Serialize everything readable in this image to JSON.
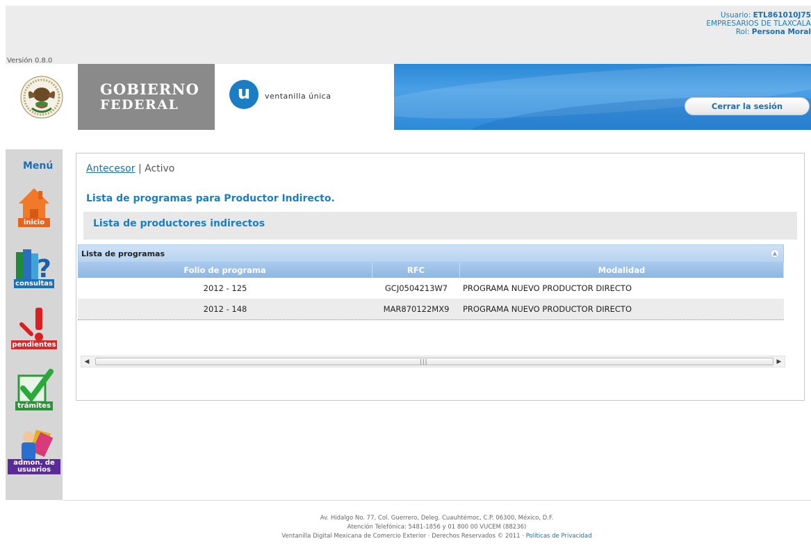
{
  "header": {
    "version": "Versión 0.8.0",
    "user_label": "Usuario:",
    "user_id": "ETL861010J75",
    "company": "EMPRESARIOS DE TLAXCALA",
    "role_label": "Rol:",
    "role": "Persona Moral"
  },
  "banner": {
    "gobierno_line1": "Gobierno",
    "gobierno_line2": "FEDERAL",
    "vu_letter": "u",
    "vu_text": "ventanilla única",
    "logout_label": "Cerrar la sesión"
  },
  "sidebar": {
    "title": "Menú",
    "items": [
      {
        "label": "inicio",
        "icon": "house-icon"
      },
      {
        "label": "consultas",
        "icon": "question-icon"
      },
      {
        "label": "pendientes",
        "icon": "exclamation-icon"
      },
      {
        "label": "trámites",
        "icon": "checkmark-icon"
      },
      {
        "label": "admon. de usuarios",
        "icon": "users-icon"
      }
    ]
  },
  "content": {
    "breadcrumb_link": "Antecesor",
    "breadcrumb_sep": "|",
    "breadcrumb_current": "Activo",
    "title": "Lista de programas para Productor Indirecto.",
    "subtitle": "Lista de productores indirectos",
    "grid": {
      "caption": "Lista de programas",
      "columns": [
        "Folio de programa",
        "RFC",
        "Modalidad"
      ],
      "rows": [
        {
          "folio": "2012 - 125",
          "rfc": "GCJ0504213W7",
          "modalidad": "PROGRAMA NUEVO PRODUCTOR DIRECTO"
        },
        {
          "folio": "2012 - 148",
          "rfc": "MAR870122MX9",
          "modalidad": "PROGRAMA NUEVO PRODUCTOR DIRECTO"
        }
      ]
    }
  },
  "footer": {
    "line1": "Av. Hidalgo No. 77, Col. Guerrero, Deleg. Cuauhtémoc, C.P. 06300, México, D.F.",
    "line2": "Atención Telefónica: 5481-1856 y 01 800 00 VUCEM (88236)",
    "line3": "Ventanilla Digital Mexicana de Comercio Exterior · Derechos Reservados © 2011 ·",
    "privacy_link": "Políticas de Privacidad"
  },
  "colors": {
    "accent_blue": "#1a6fb5",
    "banner_blue": "#2a88d6",
    "gobierno_gray": "#8a8a8a",
    "grid_header": "#8db7e3"
  }
}
